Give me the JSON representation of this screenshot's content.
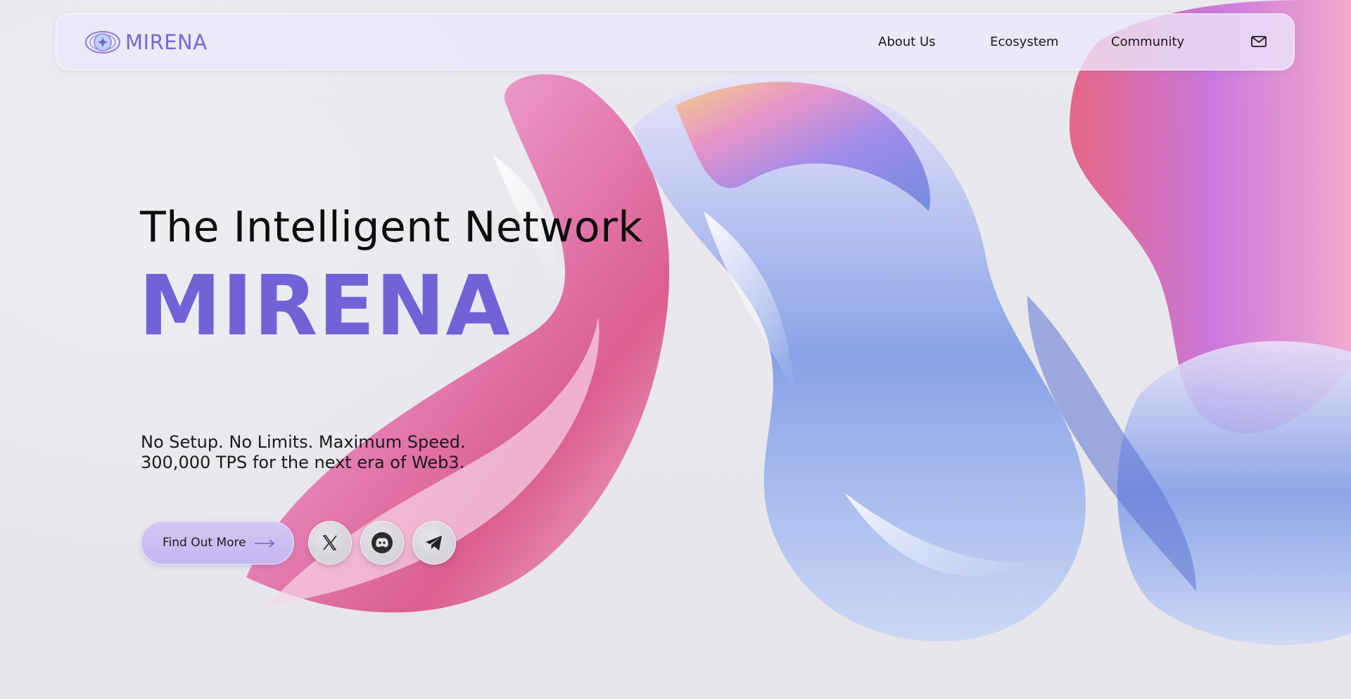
{
  "brand": {
    "name": "MIRENA",
    "logo_icon": "eye-star-icon",
    "accent_color": "#7262d8"
  },
  "nav": {
    "links": [
      {
        "label": "About Us"
      },
      {
        "label": "Ecosystem"
      },
      {
        "label": "Community"
      }
    ],
    "mail_icon": "mail-icon"
  },
  "hero": {
    "title": "The Intelligent Network",
    "brand": "MIRENA",
    "subtitle_line1": "No Setup. No Limits. Maximum Speed.",
    "subtitle_line2": "300,000 TPS for the next era of Web3."
  },
  "cta": {
    "label": "Find Out More",
    "icon": "arrow-right-icon"
  },
  "social": [
    {
      "icon": "x-twitter-icon"
    },
    {
      "icon": "discord-icon"
    },
    {
      "icon": "telegram-icon"
    }
  ]
}
